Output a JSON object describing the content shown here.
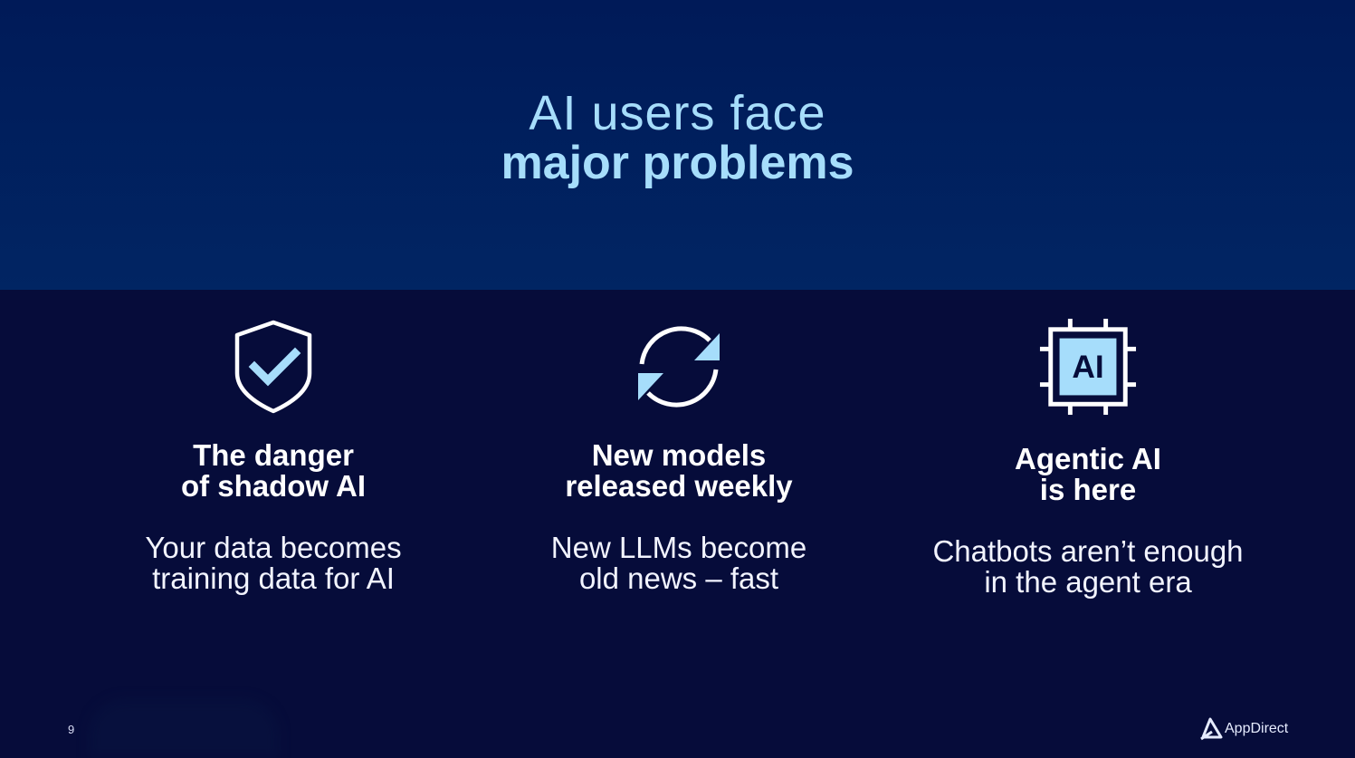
{
  "colors": {
    "top_band": "#012563",
    "bottom_band": "#060c3a",
    "accent": "#a6ddfb",
    "text": "#ffffff"
  },
  "headline": {
    "line1": "AI users face",
    "line2": "major problems"
  },
  "cards": [
    {
      "icon": "shield-check-icon",
      "title": [
        "The danger",
        "of shadow AI"
      ],
      "description": [
        "Your data becomes",
        "training data for AI"
      ]
    },
    {
      "icon": "refresh-arrows-icon",
      "title": [
        "New models",
        "released weekly"
      ],
      "description": [
        "New LLMs become",
        "old news – fast"
      ]
    },
    {
      "icon": "ai-chip-icon",
      "icon_text": "AI",
      "title": [
        "Agentic AI",
        "is here"
      ],
      "description": [
        "Chatbots aren’t enough",
        "in the agent era"
      ]
    }
  ],
  "footer": {
    "page_number": "9",
    "brand": "AppDirect",
    "brand_icon": "appdirect-logo-icon"
  }
}
